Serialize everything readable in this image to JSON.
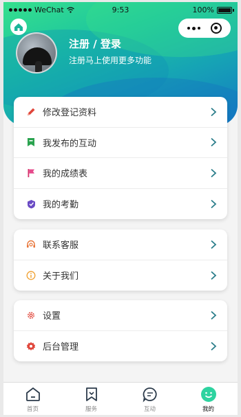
{
  "status_bar": {
    "carrier": "WeChat",
    "time": "9:53",
    "battery": "100%"
  },
  "profile": {
    "title": "注册 / 登录",
    "subtitle": "注册马上使用更多功能"
  },
  "menu_groups": [
    {
      "items": [
        {
          "label": "修改登记资料",
          "icon": "pencil-icon"
        },
        {
          "label": "我发布的互动",
          "icon": "bookmark-icon"
        },
        {
          "label": "我的成绩表",
          "icon": "flag-icon"
        },
        {
          "label": "我的考勤",
          "icon": "shield-icon"
        }
      ]
    },
    {
      "items": [
        {
          "label": "联系客服",
          "icon": "headset-icon"
        },
        {
          "label": "关于我们",
          "icon": "info-icon"
        }
      ]
    },
    {
      "items": [
        {
          "label": "设置",
          "icon": "gear-icon"
        },
        {
          "label": "后台管理",
          "icon": "admin-gear-icon"
        }
      ]
    }
  ],
  "tabbar": {
    "tabs": [
      {
        "label": "首页",
        "icon": "home-icon"
      },
      {
        "label": "服务",
        "icon": "bookmark-icon"
      },
      {
        "label": "互动",
        "icon": "chat-icon"
      },
      {
        "label": "我的",
        "icon": "smiley-icon"
      }
    ],
    "active_index": 3
  },
  "colors": {
    "accent": "#1cc4a0",
    "chevron": "#2a7d8a"
  }
}
